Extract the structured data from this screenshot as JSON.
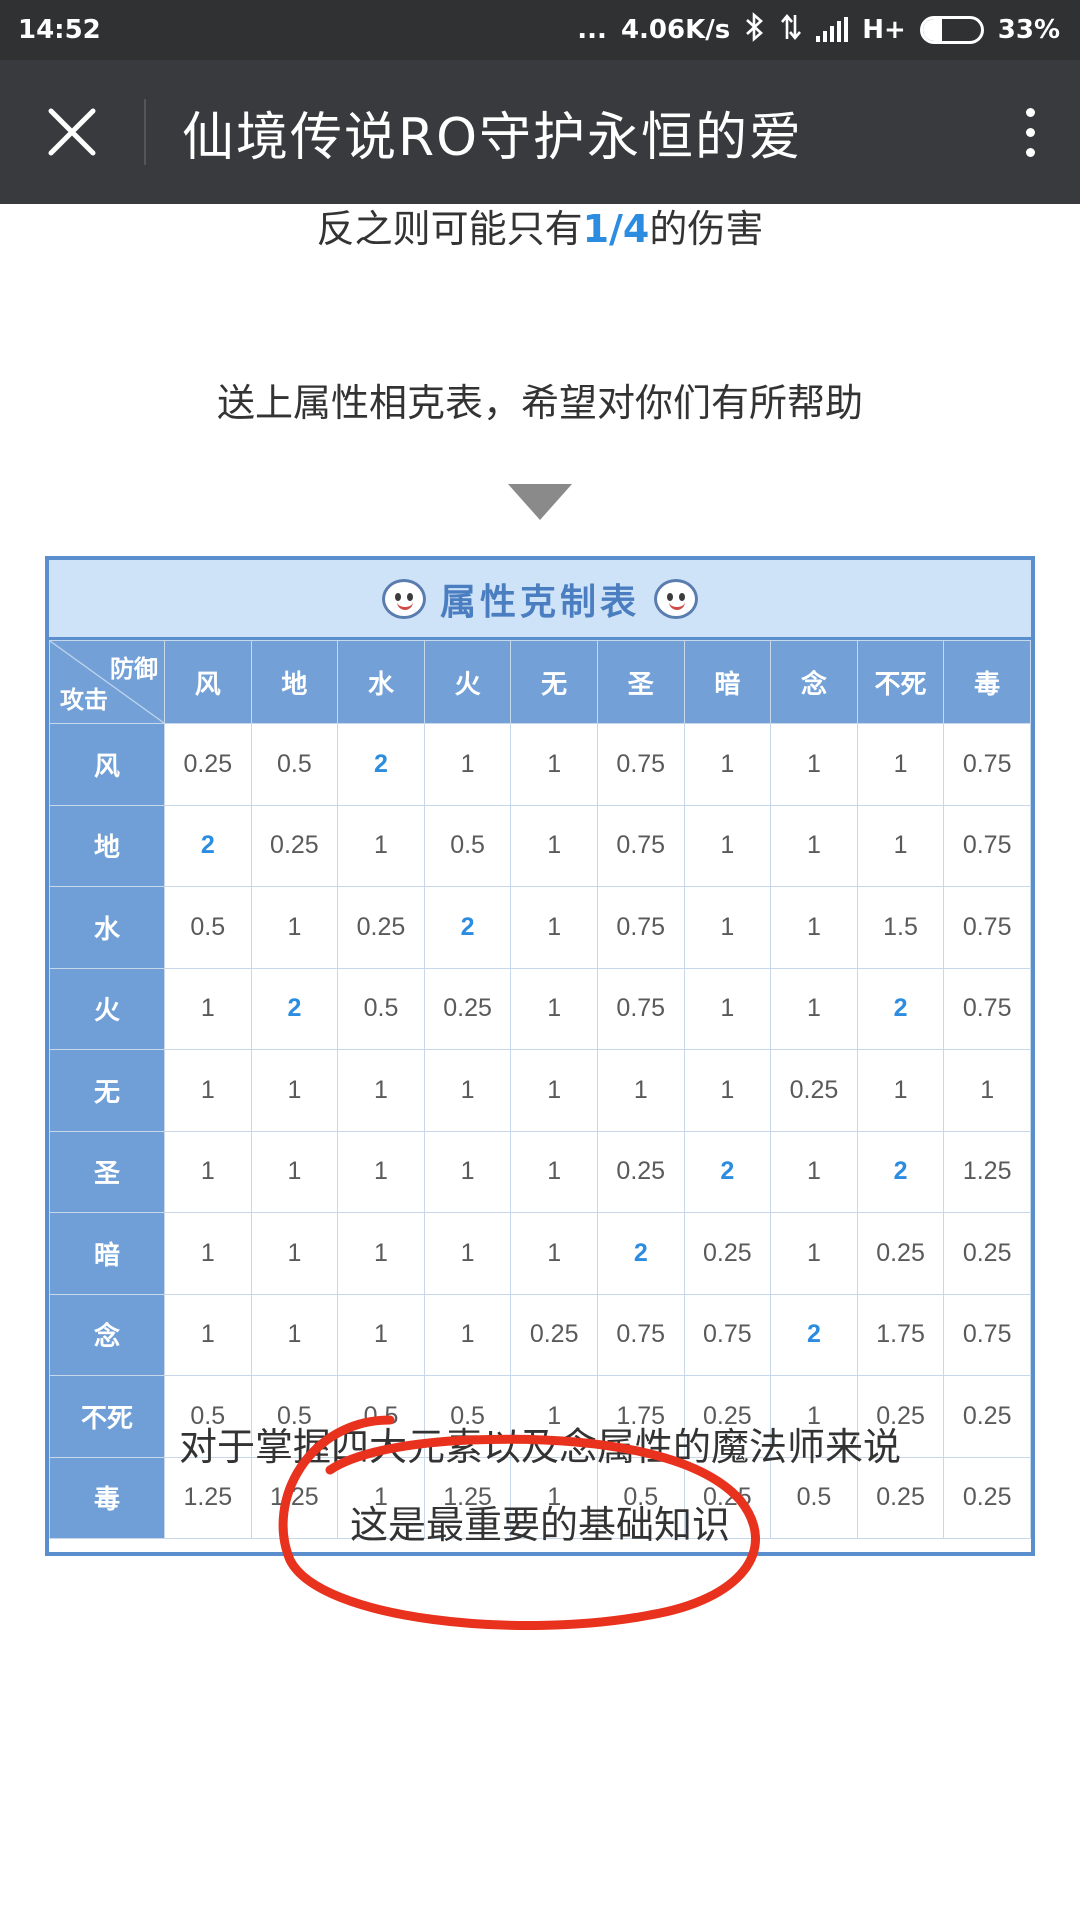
{
  "status_bar": {
    "time": "14:52",
    "dots": "...",
    "speed": "4.06K/s",
    "network": "H+",
    "battery_percent": "33%",
    "battery_level": 0.33,
    "icons": [
      "bluetooth-icon",
      "data-arrows-icon",
      "signal-icon",
      "battery-icon"
    ]
  },
  "app_bar": {
    "title": "仙境传说RO守护永恒的爱",
    "close_icon": "close-icon",
    "more_icon": "more-vertical-icon"
  },
  "article": {
    "line1_before": "反之则可能只有",
    "line1_highlight": "1/4",
    "line1_after": "的伤害",
    "line2": "送上属性相克表，希望对你们有所帮助",
    "line3": "对于掌握四大元素以及念属性的魔法师来说",
    "line4": "这是最重要的基础知识",
    "highlight_color": "#2b8ce0"
  },
  "chart_data": {
    "type": "table",
    "title": "属性克制表",
    "corner_defense": "防御",
    "corner_attack": "攻击",
    "columns": [
      "风",
      "地",
      "水",
      "火",
      "无",
      "圣",
      "暗",
      "念",
      "不死",
      "毒"
    ],
    "rows": [
      {
        "label": "风",
        "values": [
          "0.25",
          "0.5",
          "2",
          "1",
          "1",
          "0.75",
          "1",
          "1",
          "1",
          "0.75"
        ]
      },
      {
        "label": "地",
        "values": [
          "2",
          "0.25",
          "1",
          "0.5",
          "1",
          "0.75",
          "1",
          "1",
          "1",
          "0.75"
        ]
      },
      {
        "label": "水",
        "values": [
          "0.5",
          "1",
          "0.25",
          "2",
          "1",
          "0.75",
          "1",
          "1",
          "1.5",
          "0.75"
        ]
      },
      {
        "label": "火",
        "values": [
          "1",
          "2",
          "0.5",
          "0.25",
          "1",
          "0.75",
          "1",
          "1",
          "2",
          "0.75"
        ]
      },
      {
        "label": "无",
        "values": [
          "1",
          "1",
          "1",
          "1",
          "1",
          "1",
          "1",
          "0.25",
          "1",
          "1"
        ]
      },
      {
        "label": "圣",
        "values": [
          "1",
          "1",
          "1",
          "1",
          "1",
          "0.25",
          "2",
          "1",
          "2",
          "1.25"
        ]
      },
      {
        "label": "暗",
        "values": [
          "1",
          "1",
          "1",
          "1",
          "1",
          "2",
          "0.25",
          "1",
          "0.25",
          "0.25"
        ]
      },
      {
        "label": "念",
        "values": [
          "1",
          "1",
          "1",
          "1",
          "0.25",
          "0.75",
          "0.75",
          "2",
          "1.75",
          "0.75"
        ]
      },
      {
        "label": "不死",
        "values": [
          "0.5",
          "0.5",
          "0.5",
          "0.5",
          "1",
          "1.75",
          "0.25",
          "1",
          "0.25",
          "0.25"
        ]
      },
      {
        "label": "毒",
        "values": [
          "1.25",
          "1.25",
          "1",
          "1.25",
          "1",
          "0.5",
          "0.25",
          "0.5",
          "0.25",
          "0.25"
        ]
      }
    ],
    "header_color": "#73a1d7",
    "strong_value_color": "#2b8ce0"
  },
  "annotation": {
    "type": "hand-drawn-circle",
    "color": "#e8321e"
  }
}
